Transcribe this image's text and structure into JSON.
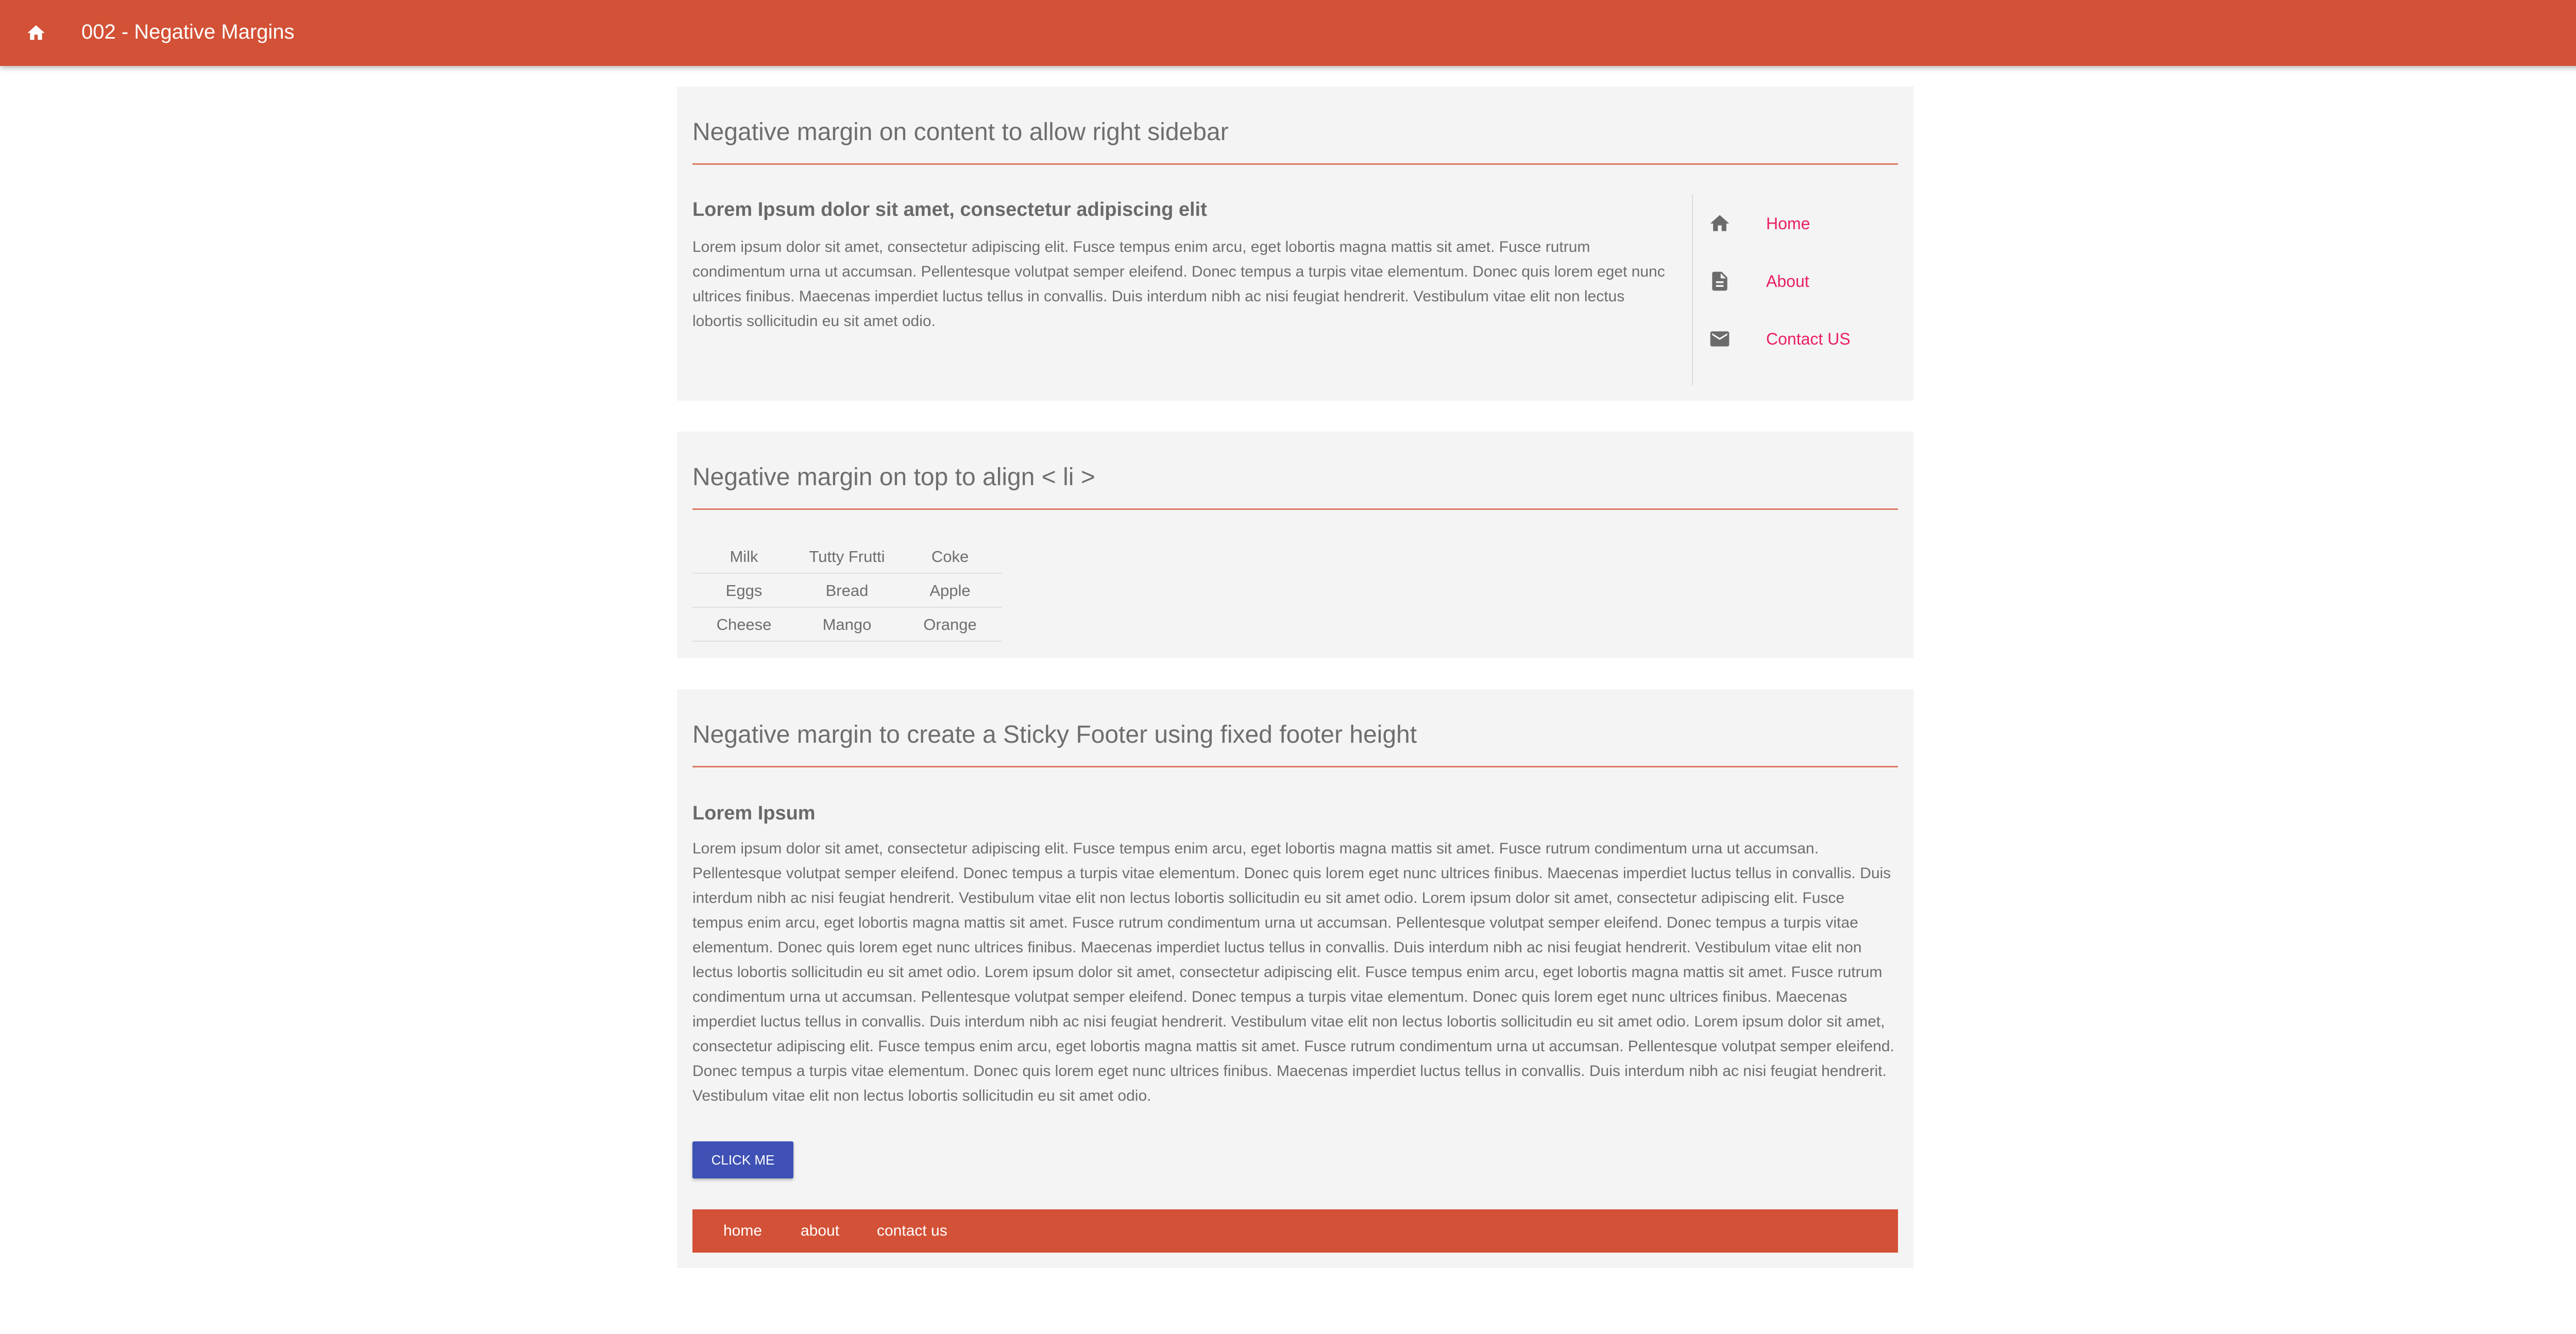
{
  "appbar": {
    "title": "002 - Negative Margins",
    "home_icon": "home-icon"
  },
  "card1": {
    "title": "Negative margin on content to allow right sidebar",
    "heading": "Lorem Ipsum dolor sit amet, consectetur adipiscing elit",
    "body": "Lorem ipsum dolor sit amet, consectetur adipiscing elit. Fusce tempus enim arcu, eget lobortis magna mattis sit amet. Fusce rutrum condimentum urna ut accumsan. Pellentesque volutpat semper eleifend. Donec tempus a turpis vitae elementum. Donec quis lorem eget nunc ultrices finibus. Maecenas imperdiet luctus tellus in convallis. Duis interdum nibh ac nisi feugiat hendrerit. Vestibulum vitae elit non lectus lobortis sollicitudin eu sit amet odio.",
    "sidebar": {
      "items": [
        {
          "icon": "home-icon",
          "label": "Home"
        },
        {
          "icon": "document-icon",
          "label": "About"
        },
        {
          "icon": "mail-icon",
          "label": "Contact US"
        }
      ]
    }
  },
  "card2": {
    "title": "Negative margin on top to align < li >",
    "rows": [
      [
        "Milk",
        "Tutty Frutti",
        "Coke"
      ],
      [
        "Eggs",
        "Bread",
        "Apple"
      ],
      [
        "Cheese",
        "Mango",
        "Orange"
      ]
    ]
  },
  "card3": {
    "title": "Negative margin to create a Sticky Footer using fixed footer height",
    "heading": "Lorem Ipsum",
    "body": "Lorem ipsum dolor sit amet, consectetur adipiscing elit. Fusce tempus enim arcu, eget lobortis magna mattis sit amet. Fusce rutrum condimentum urna ut accumsan. Pellentesque volutpat semper eleifend. Donec tempus a turpis vitae elementum. Donec quis lorem eget nunc ultrices finibus. Maecenas imperdiet luctus tellus in convallis. Duis interdum nibh ac nisi feugiat hendrerit. Vestibulum vitae elit non lectus lobortis sollicitudin eu sit amet odio. Lorem ipsum dolor sit amet, consectetur adipiscing elit. Fusce tempus enim arcu, eget lobortis magna mattis sit amet. Fusce rutrum condimentum urna ut accumsan. Pellentesque volutpat semper eleifend. Donec tempus a turpis vitae elementum. Donec quis lorem eget nunc ultrices finibus. Maecenas imperdiet luctus tellus in convallis. Duis interdum nibh ac nisi feugiat hendrerit. Vestibulum vitae elit non lectus lobortis sollicitudin eu sit amet odio. Lorem ipsum dolor sit amet, consectetur adipiscing elit. Fusce tempus enim arcu, eget lobortis magna mattis sit amet. Fusce rutrum condimentum urna ut accumsan. Pellentesque volutpat semper eleifend. Donec tempus a turpis vitae elementum. Donec quis lorem eget nunc ultrices finibus. Maecenas imperdiet luctus tellus in convallis. Duis interdum nibh ac nisi feugiat hendrerit. Vestibulum vitae elit non lectus lobortis sollicitudin eu sit amet odio. Lorem ipsum dolor sit amet, consectetur adipiscing elit. Fusce tempus enim arcu, eget lobortis magna mattis sit amet. Fusce rutrum condimentum urna ut accumsan. Pellentesque volutpat semper eleifend. Donec tempus a turpis vitae elementum. Donec quis lorem eget nunc ultrices finibus. Maecenas imperdiet luctus tellus in convallis. Duis interdum nibh ac nisi feugiat hendrerit. Vestibulum vitae elit non lectus lobortis sollicitudin eu sit amet odio.",
    "button_label": "CLICK ME",
    "footer_links": [
      "home",
      "about",
      "contact us"
    ]
  },
  "colors": {
    "primary": "#d35136",
    "accent_link": "#e91e63",
    "button": "#3f51b5",
    "card_bg": "#f4f4f4"
  }
}
